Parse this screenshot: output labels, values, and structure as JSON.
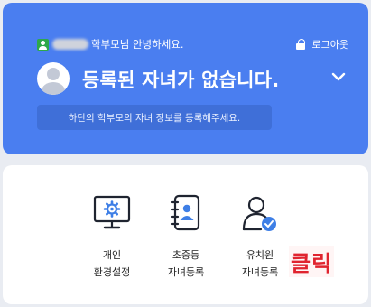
{
  "header": {
    "greeting_suffix": "학부모님 안녕하세요.",
    "logout_label": "로그아웃",
    "headline": "등록된 자녀가 없습니다.",
    "notice": "하단의 학부모의 자녀 정보를 등록해주세요."
  },
  "menu": {
    "items": [
      {
        "line1": "개인",
        "line2": "환경설정",
        "icon": "monitor-settings-icon"
      },
      {
        "line1": "초중등",
        "line2": "자녀등록",
        "icon": "contact-book-icon"
      },
      {
        "line1": "유치원",
        "line2": "자녀등록",
        "icon": "person-check-icon"
      }
    ]
  },
  "annotation": {
    "click_label": "클릭",
    "color": "#e0242f"
  },
  "colors": {
    "header_bg": "#4a7ef0",
    "notice_bg": "#3f6fd8",
    "user_icon": "#2ea84a",
    "accent_icon": "#3e7fe6"
  }
}
